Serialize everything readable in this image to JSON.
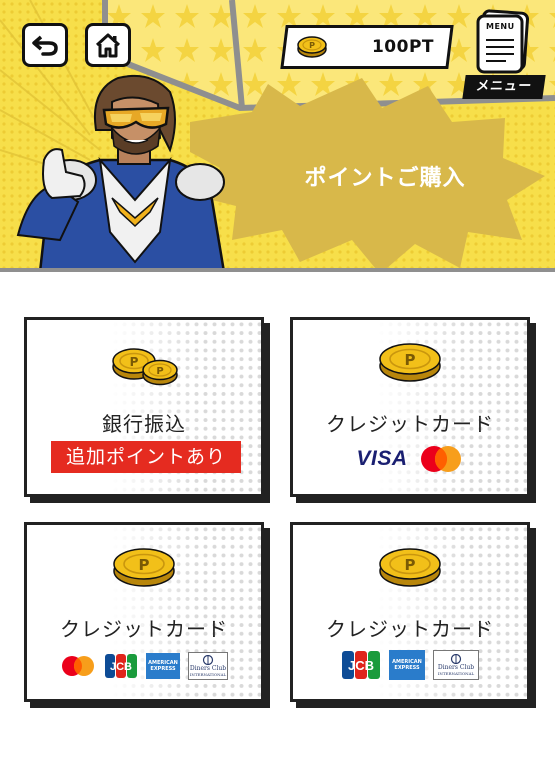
{
  "header": {
    "back_icon": "back-arrow-icon",
    "home_icon": "home-icon",
    "points": {
      "value": "100PT",
      "icon": "coin-icon"
    },
    "menu": {
      "paper_text": "MENU",
      "label": "メニュー"
    },
    "title": "ポイントご購入"
  },
  "cards": [
    {
      "title": "銀行振込",
      "badge": "追加ポイントあり",
      "icon": "two-coins-icon"
    },
    {
      "title": "クレジットカード",
      "brands": [
        "VISA",
        "Mastercard"
      ]
    },
    {
      "title": "クレジットカード",
      "brands": [
        "Mastercard",
        "JCB",
        "American Express",
        "Diners Club International"
      ]
    },
    {
      "title": "クレジットカード",
      "brands": [
        "JCB",
        "American Express",
        "Diners Club International"
      ]
    }
  ],
  "logos": {
    "visa": "VISA",
    "jcb": "JCB",
    "amex": [
      "AMERICAN",
      "EXPRESS"
    ],
    "diners": [
      "Diners Club",
      "INTERNATIONAL"
    ]
  },
  "colors": {
    "header_yellow": "#f7df4a",
    "burst": "#d8b84a",
    "badge_red": "#e52b20",
    "coin_gold": "#f2c019",
    "visa_blue": "#1a1f71",
    "amex_blue": "#2a7ccb",
    "mastercard_red": "#eb001b",
    "mastercard_orange": "#f79e1b"
  }
}
